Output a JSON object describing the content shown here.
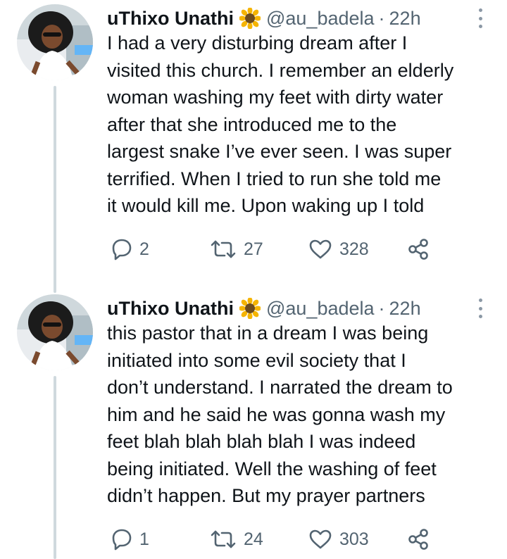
{
  "tweets": [
    {
      "name": "uThixo Unathi",
      "emoji": "sunflower",
      "handle": "@au_badela",
      "separator": "·",
      "time": "22h",
      "lines": [
        "I had a very disturbing dream after I",
        "visited this church. I remember an elderly",
        "woman washing my feet with dirty water",
        "after that she introduced me to the",
        "largest snake I’ve ever seen. I was super",
        "terrified. When I tried to run she told me",
        "it would kill me. Upon waking up I told"
      ],
      "replies": "2",
      "retweets": "27",
      "likes": "328"
    },
    {
      "name": "uThixo Unathi",
      "emoji": "sunflower",
      "handle": "@au_badela",
      "separator": "·",
      "time": "22h",
      "lines": [
        "this pastor that in a dream I was being",
        "initiated into some evil society that I",
        "don’t understand. I narrated the dream to",
        "him and he said he was gonna wash my",
        "feet blah blah blah blah I was indeed",
        "being initiated. Well the washing of feet",
        "didn’t happen. But my prayer partners"
      ],
      "replies": "1",
      "retweets": "24",
      "likes": "303"
    }
  ],
  "icons": {
    "reply": "reply-icon",
    "retweet": "retweet-icon",
    "like": "heart-icon",
    "share": "share-icon",
    "more": "more-options-icon"
  },
  "colors": {
    "text": "#0f1419",
    "secondary": "#536471",
    "thread_line": "#cfd9de"
  }
}
